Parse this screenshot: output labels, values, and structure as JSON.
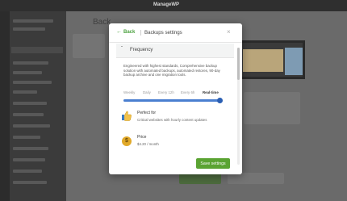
{
  "background": {
    "brand": "ManageWP",
    "page_title_partial": "Back"
  },
  "modal": {
    "back_label": "Back",
    "title": "Backups settings",
    "close_glyph": "×",
    "section": {
      "title": "Frequency",
      "expanded": true
    },
    "description": "Engineered with highest standards, Comprehensive backup solution with automated backups, automated restores, 90-day backup archive and one migration tools.",
    "frequency": {
      "options": [
        "Weekly",
        "Daily",
        "Every 12h",
        "Every 6h",
        "Real-time"
      ],
      "selected": "Real-time",
      "level_percent": 100
    },
    "perfect_for": {
      "title": "Perfect for",
      "text": "Critical websites with hourly content updates"
    },
    "price": {
      "title": "Price",
      "value": "$4.20 / month",
      "icon_glyph": "$"
    },
    "save_label": "Save settings"
  },
  "colors": {
    "accent_green": "#5aa332",
    "slider_blue": "#2b5fb3"
  }
}
